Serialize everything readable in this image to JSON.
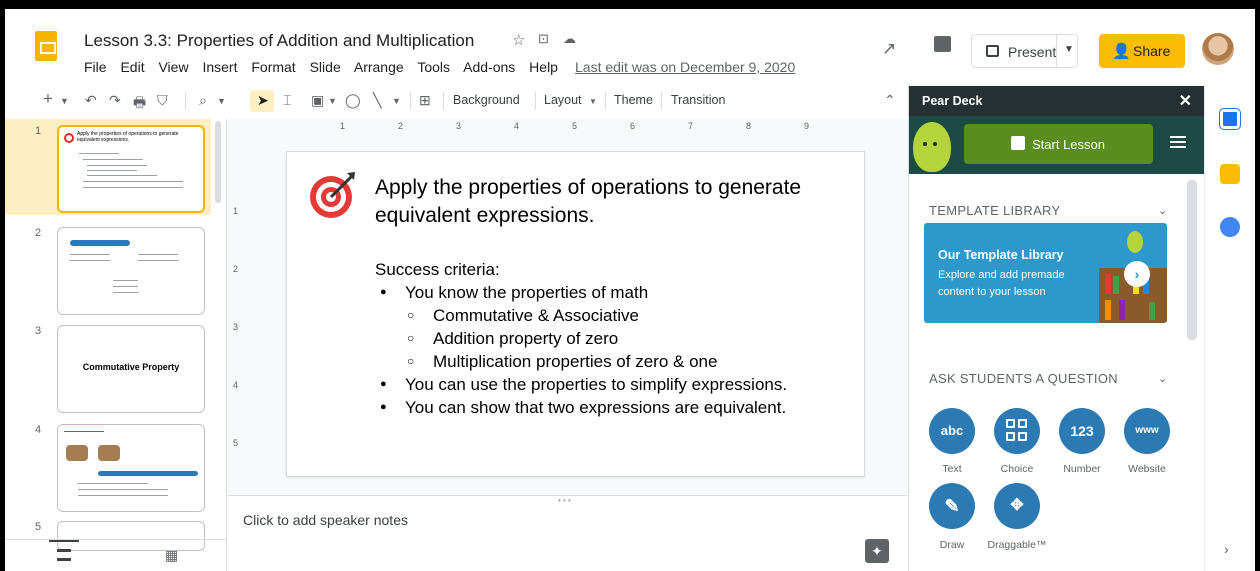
{
  "header": {
    "title": "Lesson 3.3: Properties of Addition and Multiplication",
    "menu": [
      "File",
      "Edit",
      "View",
      "Insert",
      "Format",
      "Slide",
      "Arrange",
      "Tools",
      "Add-ons",
      "Help"
    ],
    "last_edit": "Last edit was on December 9, 2020",
    "present_label": "Present",
    "share_label": "Share"
  },
  "toolbar": {
    "background_label": "Background",
    "layout_label": "Layout",
    "theme_label": "Theme",
    "transition_label": "Transition"
  },
  "filmstrip": {
    "slides": [
      {
        "num": "1",
        "title": "Apply the properties of operations to generate equivalent expressions."
      },
      {
        "num": "2"
      },
      {
        "num": "3",
        "title": "Commutative Property"
      },
      {
        "num": "4"
      },
      {
        "num": "5"
      }
    ]
  },
  "ruler": {
    "h_ticks": [
      "1",
      "2",
      "3",
      "4",
      "5",
      "6",
      "7",
      "8",
      "9"
    ],
    "v_ticks": [
      "1",
      "2",
      "3",
      "4",
      "5"
    ]
  },
  "slide": {
    "title": "Apply the properties of operations to generate equivalent expressions.",
    "criteria_heading": "Success criteria:",
    "bullets": [
      {
        "text": "You know the properties of math",
        "sub": [
          "Commutative & Associative",
          "Addition property of zero",
          "Multiplication properties of zero & one"
        ]
      },
      {
        "text": "You can use the properties to simplify expressions."
      },
      {
        "text": "You can show that two expressions are equivalent."
      }
    ]
  },
  "notes": {
    "placeholder": "Click to add speaker notes"
  },
  "pear_deck": {
    "title": "Pear Deck",
    "start_label": "Start Lesson",
    "template_section": "TEMPLATE LIBRARY",
    "library_heading": "Our Template Library",
    "library_desc": "Explore and add premade content to your lesson",
    "ask_section": "ASK STUDENTS A QUESTION",
    "questions": [
      {
        "icon": "abc",
        "label": "Text"
      },
      {
        "icon": "choice-grid-icon",
        "label": "Choice"
      },
      {
        "icon": "123",
        "label": "Number"
      },
      {
        "icon": "www",
        "label": "Website"
      },
      {
        "icon": "pencil-icon",
        "label": "Draw"
      },
      {
        "icon": "move-arrows-icon",
        "label": "Draggable™"
      }
    ]
  },
  "colors": {
    "accent": "#f4b400",
    "pear_dark": "#263033",
    "question_blue": "#2c7ab3",
    "start_green": "#5a8d1f"
  }
}
